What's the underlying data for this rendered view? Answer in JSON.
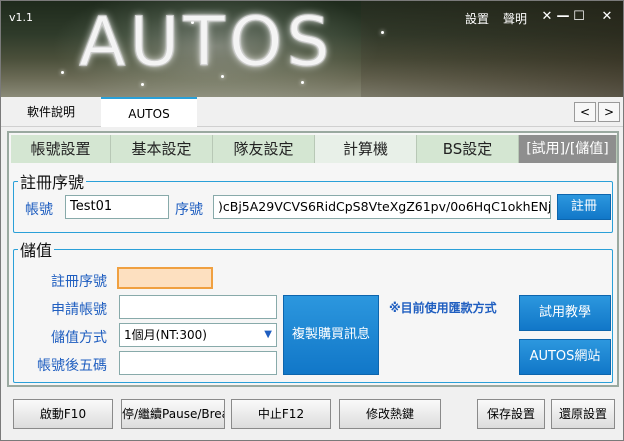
{
  "app": {
    "version": "v1.1",
    "logo": "AUTOS"
  },
  "header_links": {
    "settings": "設置",
    "help": "聲明"
  },
  "window_controls": {
    "close": "✕",
    "minimize": "—",
    "maximize": "☐",
    "close2": "✕"
  },
  "top_tabs": [
    {
      "label": "軟件說明"
    },
    {
      "label": "AUTOS"
    }
  ],
  "nav_arrows": {
    "prev": "<",
    "next": ">"
  },
  "function_tabs": [
    {
      "label": "帳號設置"
    },
    {
      "label": "基本設定"
    },
    {
      "label": "隊友設定"
    },
    {
      "label": "計算機"
    },
    {
      "label": "BS設定"
    },
    {
      "label": "[試用]/[儲值]"
    }
  ],
  "register": {
    "legend": "註冊序號",
    "account_label": "帳號",
    "account_value": "Test01",
    "serial_label": "序號",
    "serial_value": ")cBj5A29VCVS6RidCpS8VteXgZ61pv/0o6HqC1okhENj",
    "register_button": "註冊"
  },
  "topup": {
    "legend": "儲值",
    "serial_label": "註冊序號",
    "apply_account_label": "申請帳號",
    "method_label": "儲值方式",
    "method_value": "1個月(NT:300)",
    "last5_label": "帳號後五碼",
    "copy_button": "複製購買訊息",
    "note": "※目前使用匯款方式",
    "trial_button": "試用教學",
    "site_button": "AUTOS網站"
  },
  "bottom_buttons": {
    "start": "啟動F10",
    "pause": "停/繼續Pause/Break",
    "stop": "中止F12",
    "hotkey": "修改熱鍵",
    "save": "保存設置",
    "restore": "還原設置"
  },
  "colors": {
    "accent": "#2aa0d8",
    "label_blue": "#1f5ec0",
    "button_blue": "#1a86d2",
    "highlight_orange": "#f0a040"
  }
}
